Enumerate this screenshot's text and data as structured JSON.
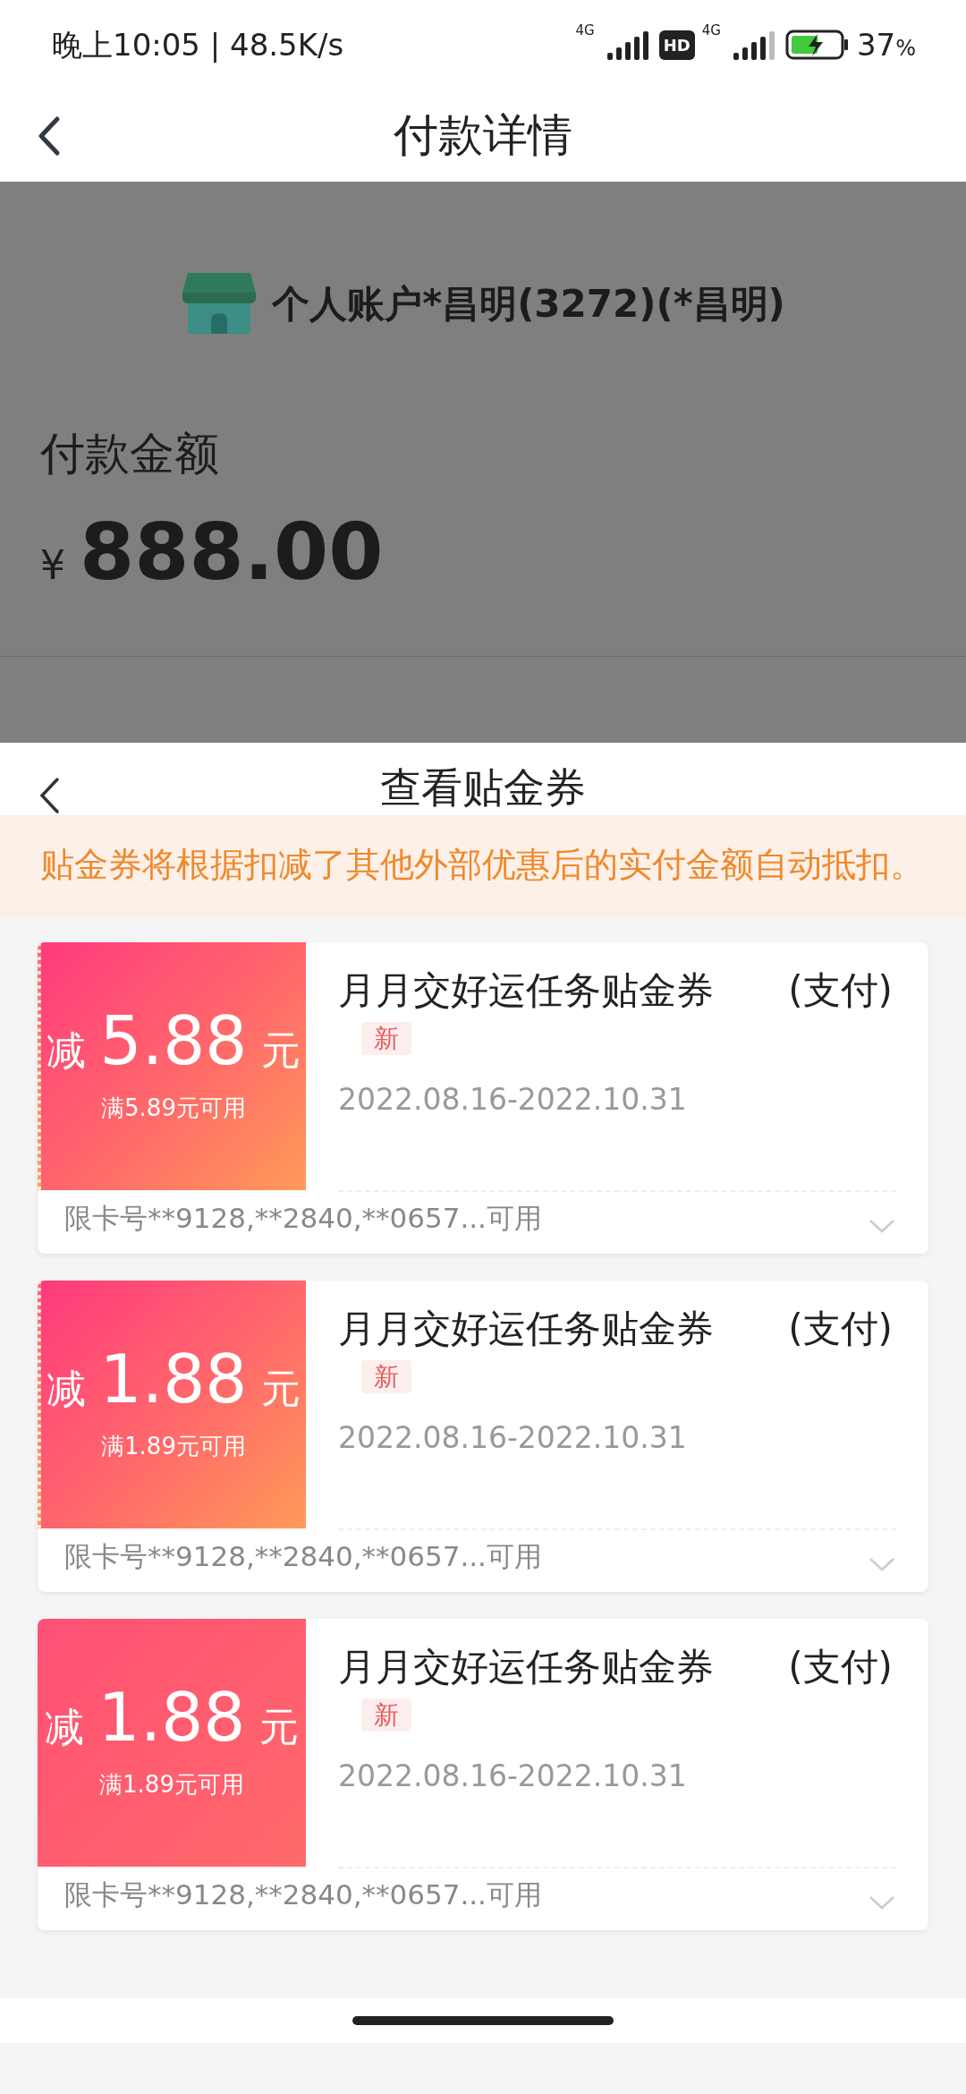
{
  "status_bar": {
    "time": "晚上10:05 | 48.5K/s",
    "sim1_label": "4G",
    "hd_label": "HD",
    "sim2_label": "4G",
    "battery": "37",
    "battery_unit": "%"
  },
  "header": {
    "title": "付款详情"
  },
  "payee": {
    "name": "个人账户*昌明(3272)(*昌明)"
  },
  "amount": {
    "label": "付款金额",
    "currency": "¥",
    "value": "888.00"
  },
  "sheet": {
    "title": "查看贴金券",
    "notice": "贴金券将根据扣减了其他外部优惠后的实付金额自动抵扣。"
  },
  "coupons": [
    {
      "kind": "gradient",
      "prefix": "减",
      "amount": "5.88",
      "unit": "元",
      "condition": "满5.89元可用",
      "title": "月月交好运任务贴金券",
      "title_suffix": "(支付)",
      "badge": "新",
      "dates": "2022.08.16-2022.10.31",
      "cards": "限卡号**9128,**2840,**0657...可用"
    },
    {
      "kind": "gradient",
      "prefix": "减",
      "amount": "1.88",
      "unit": "元",
      "condition": "满1.89元可用",
      "title": "月月交好运任务贴金券",
      "title_suffix": "(支付)",
      "badge": "新",
      "dates": "2022.08.16-2022.10.31",
      "cards": "限卡号**9128,**2840,**0657...可用"
    },
    {
      "kind": "flat",
      "prefix": "减",
      "amount": "1.88",
      "unit": "元",
      "condition": "满1.89元可用",
      "title": "月月交好运任务贴金券",
      "title_suffix": "(支付)",
      "badge": "新",
      "dates": "2022.08.16-2022.10.31",
      "cards": "限卡号**9128,**2840,**0657...可用"
    }
  ]
}
